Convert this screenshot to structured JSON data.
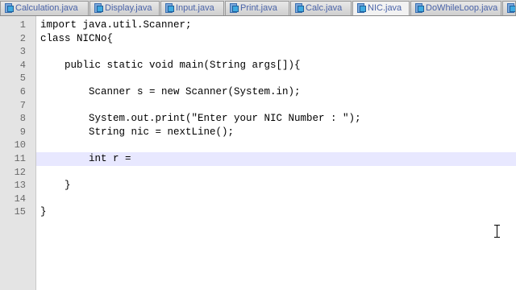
{
  "tabs": [
    {
      "label": "Calculation.java",
      "icon": "java-file-icon",
      "active": false
    },
    {
      "label": "Display.java",
      "icon": "java-file-icon",
      "active": false
    },
    {
      "label": "Input.java",
      "icon": "java-file-icon",
      "active": false
    },
    {
      "label": "Print.java",
      "icon": "java-file-icon",
      "active": false
    },
    {
      "label": "Calc.java",
      "icon": "java-file-icon",
      "active": false
    },
    {
      "label": "NIC.java",
      "icon": "java-file-icon",
      "active": true
    },
    {
      "label": "DoWhileLoop.java",
      "icon": "java-file-icon",
      "active": false
    },
    {
      "label": "",
      "icon": "java-file-icon",
      "active": false
    }
  ],
  "editor": {
    "current_line": 11,
    "lines": [
      {
        "number": "1",
        "text": "import java.util.Scanner;"
      },
      {
        "number": "2",
        "text": "class NICNo{"
      },
      {
        "number": "3",
        "text": ""
      },
      {
        "number": "4",
        "text": "    public static void main(String args[]){"
      },
      {
        "number": "5",
        "text": ""
      },
      {
        "number": "6",
        "text": "        Scanner s = new Scanner(System.in);"
      },
      {
        "number": "7",
        "text": ""
      },
      {
        "number": "8",
        "text": "        System.out.print(\"Enter your NIC Number : \");"
      },
      {
        "number": "9",
        "text": "        String nic = nextLine();"
      },
      {
        "number": "10",
        "text": ""
      },
      {
        "number": "11",
        "text": "        int r ="
      },
      {
        "number": "12",
        "text": ""
      },
      {
        "number": "13",
        "text": "    }"
      },
      {
        "number": "14",
        "text": ""
      },
      {
        "number": "15",
        "text": "}"
      }
    ]
  },
  "colors": {
    "current_line_highlight": "#e8e8ff",
    "gutter_background": "#e4e4e4",
    "tab_text": "#4a63a8"
  }
}
